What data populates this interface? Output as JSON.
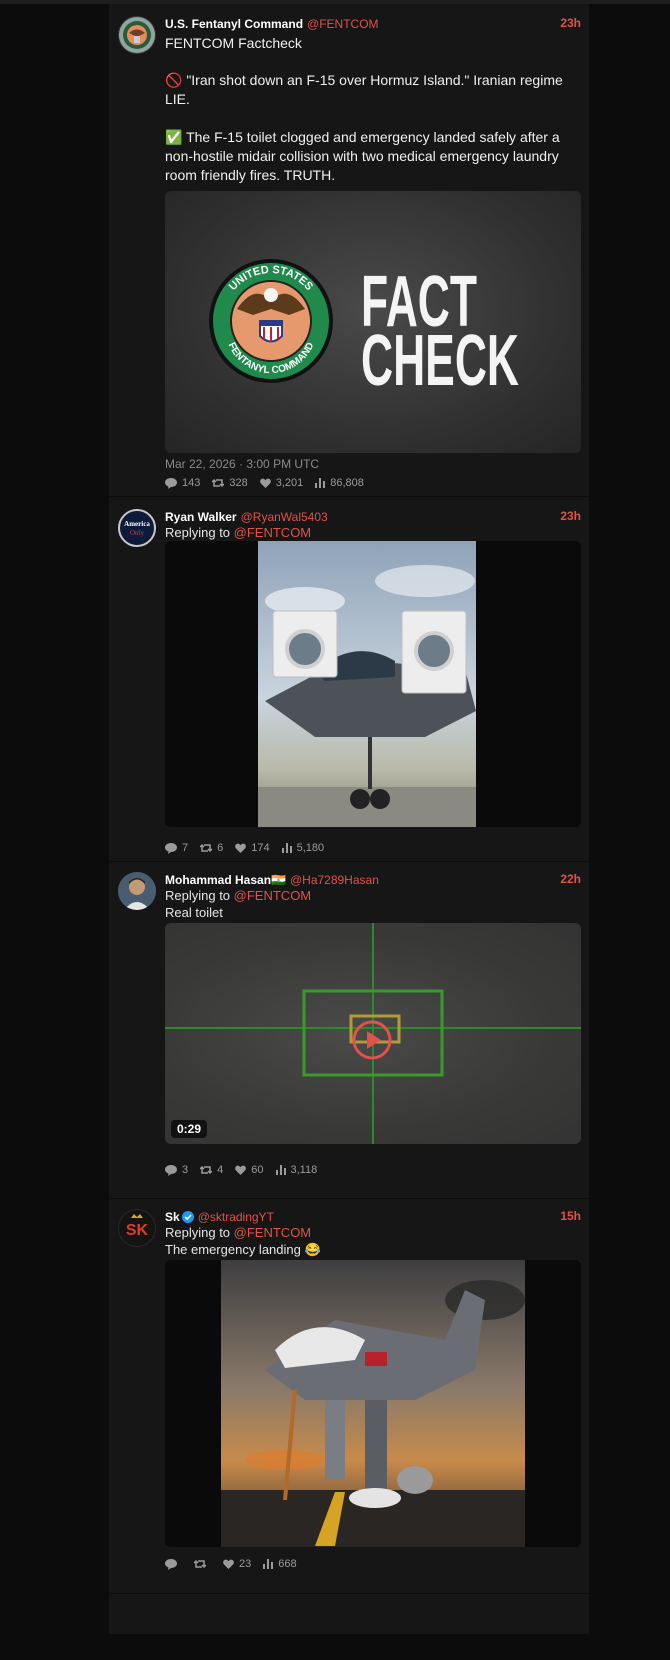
{
  "posts": [
    {
      "name": "U.S. Fentanyl Command",
      "handle": "@FENTCOM",
      "time": "23h",
      "body_title": "FENTCOM Factcheck",
      "claim_icon": "🚫",
      "claim": " \"Iran shot down an F-15 over Hormuz Island.\" Iranian regime LIE.",
      "truth_icon": "✅",
      "truth": " The F-15 toilet clogged and emergency landed safely after a non-hostile midair collision with two medical emergency laundry room friendly fires. TRUTH.",
      "card": {
        "headline_1": "FACT",
        "headline_2": "CHECK",
        "seal_top": "UNITED STATES",
        "seal_bottom": "FENTANYL COMMAND"
      },
      "date": "Mar 22, 2026 · 3:00 PM UTC",
      "stats": {
        "replies": "143",
        "reposts": "328",
        "likes": "3,201",
        "views": "86,808"
      }
    },
    {
      "name": "Ryan Walker",
      "handle": "@RyanWal5403",
      "time": "23h",
      "replying_prefix": "Replying to",
      "replying_to": "@FENTCOM",
      "avatar_text_1": "America",
      "avatar_text_2": "Only",
      "stats": {
        "replies": "7",
        "reposts": "6",
        "likes": "174",
        "views": "5,180"
      }
    },
    {
      "name": "Mohammad Hasan🇮🇳",
      "handle": "@Ha7289Hasan",
      "time": "22h",
      "replying_prefix": "Replying to",
      "replying_to": "@FENTCOM",
      "text": "Real toilet",
      "video_duration": "0:29",
      "stats": {
        "replies": "3",
        "reposts": "4",
        "likes": "60",
        "views": "3,118"
      }
    },
    {
      "name": "Sk",
      "handle": "@sktradingYT",
      "time": "15h",
      "replying_prefix": "Replying to",
      "replying_to": "@FENTCOM",
      "text": "The emergency landing 😂",
      "avatar_text": "SK",
      "stats": {
        "replies": "",
        "reposts": "",
        "likes": "23",
        "views": "668"
      }
    }
  ],
  "colors": {
    "accent": "#e0524a",
    "background": "#0c0c0c",
    "card": "#161616"
  },
  "icons": [
    "reply-icon",
    "repost-icon",
    "like-icon",
    "views-icon",
    "verified-icon",
    "play-icon"
  ]
}
